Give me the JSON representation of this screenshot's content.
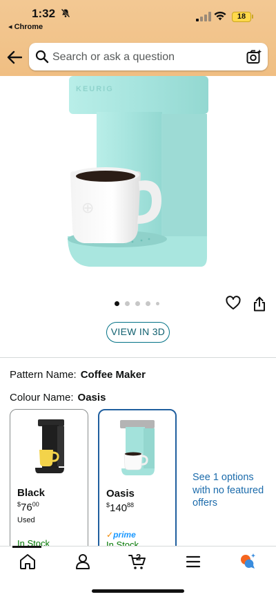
{
  "status_bar": {
    "time": "1:32",
    "back_app": "◂ Chrome",
    "battery": "18"
  },
  "search": {
    "placeholder": "Search or ask a question"
  },
  "product": {
    "brand_text": "KEURIG",
    "view_3d_label": "VIEW IN 3D",
    "carousel": {
      "count": 5,
      "active_index": 0
    }
  },
  "variants": {
    "pattern_label": "Pattern Name:",
    "pattern_value": "Coffee Maker",
    "colour_label": "Colour Name:",
    "colour_value": "Oasis",
    "options": [
      {
        "name": "Black",
        "price_currency": "$",
        "price_whole": "76",
        "price_fraction": "00",
        "condition": "Used",
        "prime": "",
        "stock": "In Stock",
        "selected": false
      },
      {
        "name": "Oasis",
        "price_currency": "$",
        "price_whole": "140",
        "price_fraction": "88",
        "condition": "",
        "prime": "prime",
        "stock": "In Stock",
        "selected": true
      }
    ],
    "other_offers": "See 1 options with no featured offers"
  },
  "bottom_nav": {
    "cart_count": "2",
    "items": [
      "home-icon",
      "account-icon",
      "cart-icon",
      "menu-icon",
      "rufus-icon"
    ]
  },
  "colors": {
    "header_bg": "#f1c38a",
    "link": "#1b6bab",
    "selected_border": "#1f5e9e",
    "in_stock": "#007600",
    "machine": "#a8e6e0"
  }
}
